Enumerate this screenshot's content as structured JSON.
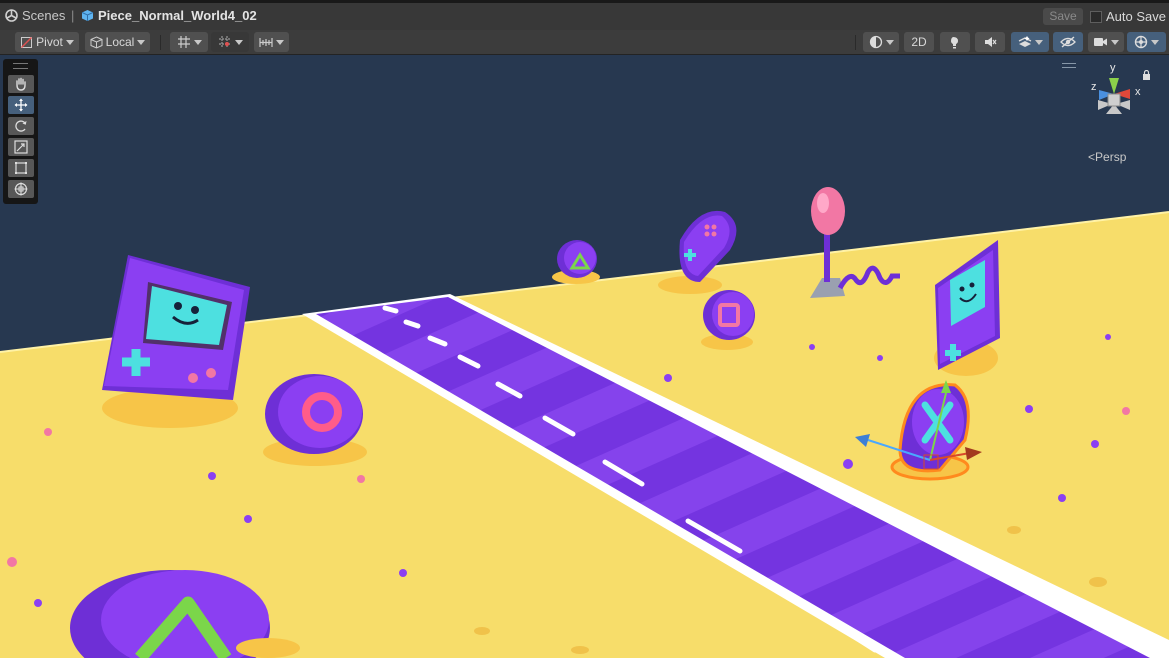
{
  "breadcrumb": {
    "scenes_label": "Scenes",
    "separator": "|",
    "scene_name": "Piece_Normal_World4_02"
  },
  "header": {
    "save_label": "Save",
    "autosave_label": "Auto Save",
    "autosave_checked": false
  },
  "toolbar": {
    "pivot_label": "Pivot",
    "local_label": "Local",
    "mode_2d_label": "2D",
    "icons": [
      "pivot-icon",
      "local-icon",
      "grid-snap-icon",
      "increment-snap-icon",
      "ruler-icon",
      "shading-mode-icon",
      "lighting-icon",
      "audio-icon",
      "effects-icon",
      "scene-visibility-icon",
      "camera-icon",
      "gizmos-icon"
    ]
  },
  "tools": {
    "items": [
      "view-tool",
      "move-tool",
      "rotate-tool",
      "scale-tool",
      "rect-tool",
      "transform-tool"
    ],
    "active": "move-tool"
  },
  "gizmo": {
    "y_label": "y",
    "x_label": "x",
    "z_label": "z",
    "projection_label": "Persp"
  },
  "colors": {
    "sky": "#273850",
    "ground": "#f7dd6a",
    "road": "#7a3fe0",
    "accent_purple": "#8b3ff2",
    "accent_cyan": "#4de0e0",
    "accent_pink": "#f277a4",
    "accent_green": "#7bd64a",
    "selection_orange": "#ff8a1e"
  }
}
